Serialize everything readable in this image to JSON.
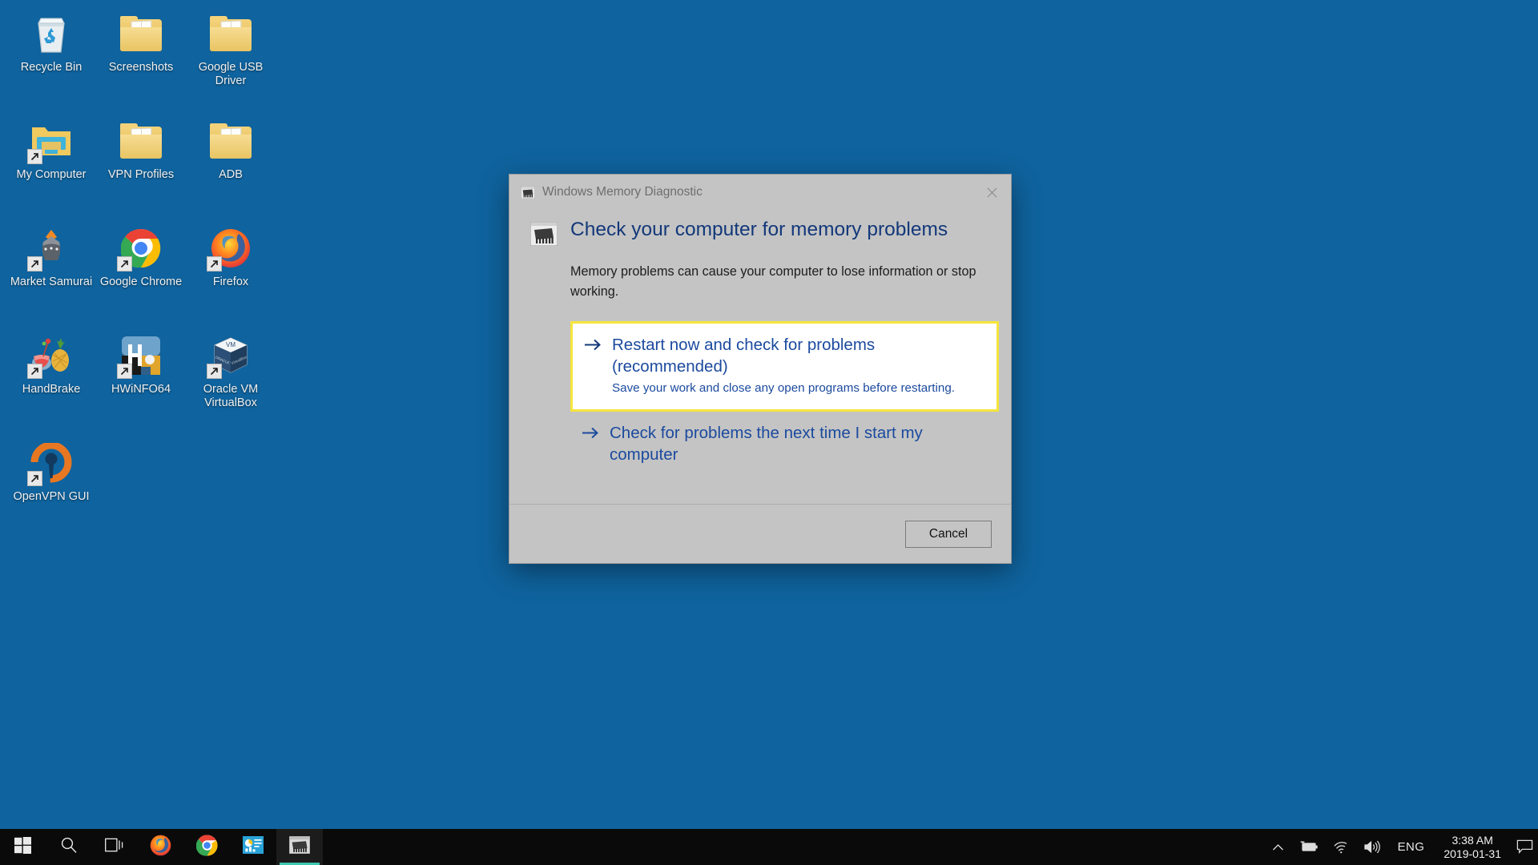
{
  "desktop": {
    "background_color": "#0f639e",
    "icons": [
      {
        "label": "Recycle Bin",
        "icon": "recycle-bin-icon",
        "shortcut": false
      },
      {
        "label": "Screenshots",
        "icon": "folder-icon",
        "shortcut": false
      },
      {
        "label": "Google USB Driver",
        "icon": "folder-icon",
        "shortcut": false
      },
      {
        "label": "My Computer",
        "icon": "my-computer-icon",
        "shortcut": true
      },
      {
        "label": "VPN Profiles",
        "icon": "folder-icon",
        "shortcut": false
      },
      {
        "label": "ADB",
        "icon": "folder-icon",
        "shortcut": false
      },
      {
        "label": "Market Samurai",
        "icon": "market-samurai-icon",
        "shortcut": true
      },
      {
        "label": "Google Chrome",
        "icon": "chrome-icon",
        "shortcut": true
      },
      {
        "label": "Firefox",
        "icon": "firefox-icon",
        "shortcut": true
      },
      {
        "label": "HandBrake",
        "icon": "handbrake-icon",
        "shortcut": true
      },
      {
        "label": "HWiNFO64",
        "icon": "hwinfo-icon",
        "shortcut": true
      },
      {
        "label": "Oracle VM VirtualBox",
        "icon": "virtualbox-icon",
        "shortcut": true
      },
      {
        "label": "OpenVPN GUI",
        "icon": "openvpn-icon",
        "shortcut": true
      }
    ]
  },
  "dialog": {
    "title": "Windows Memory Diagnostic",
    "title_icon": "memory-chip-icon",
    "close_label": "Close",
    "heading": "Check your computer for memory problems",
    "heading_icon": "memory-chip-icon",
    "description": "Memory problems can cause your computer to lose information or stop working.",
    "highlight_color": "#f5e53c",
    "link_color": "#1b4a9e",
    "options": [
      {
        "label": "Restart now and check for problems (recommended)",
        "sublabel": "Save your work and close any open programs before restarting.",
        "selected": true
      },
      {
        "label": "Check for problems the next time I start my computer",
        "sublabel": "",
        "selected": false
      }
    ],
    "cancel_label": "Cancel"
  },
  "taskbar": {
    "background_color": "#0a0a0a",
    "active_indicator_color": "#3ec8b0",
    "buttons": [
      {
        "name": "start-button",
        "icon": "windows-logo-icon",
        "active": false
      },
      {
        "name": "search-button",
        "icon": "search-icon",
        "active": false
      },
      {
        "name": "task-view-button",
        "icon": "task-view-icon",
        "active": false
      },
      {
        "name": "taskbar-firefox",
        "icon": "firefox-icon",
        "active": false
      },
      {
        "name": "taskbar-chrome",
        "icon": "chrome-icon",
        "active": false
      },
      {
        "name": "taskbar-dashboard",
        "icon": "dashboard-app-icon",
        "active": false
      },
      {
        "name": "taskbar-memory-diagnostic",
        "icon": "memory-chip-icon",
        "active": true
      }
    ],
    "tray": {
      "show_hidden_icons": "show-hidden-icons-chevron",
      "battery": "battery-charging-icon",
      "network": "wifi-icon",
      "volume": "volume-icon",
      "language": "ENG",
      "time": "3:38 AM",
      "date": "2019-01-31",
      "action_center": "action-center-icon"
    }
  }
}
